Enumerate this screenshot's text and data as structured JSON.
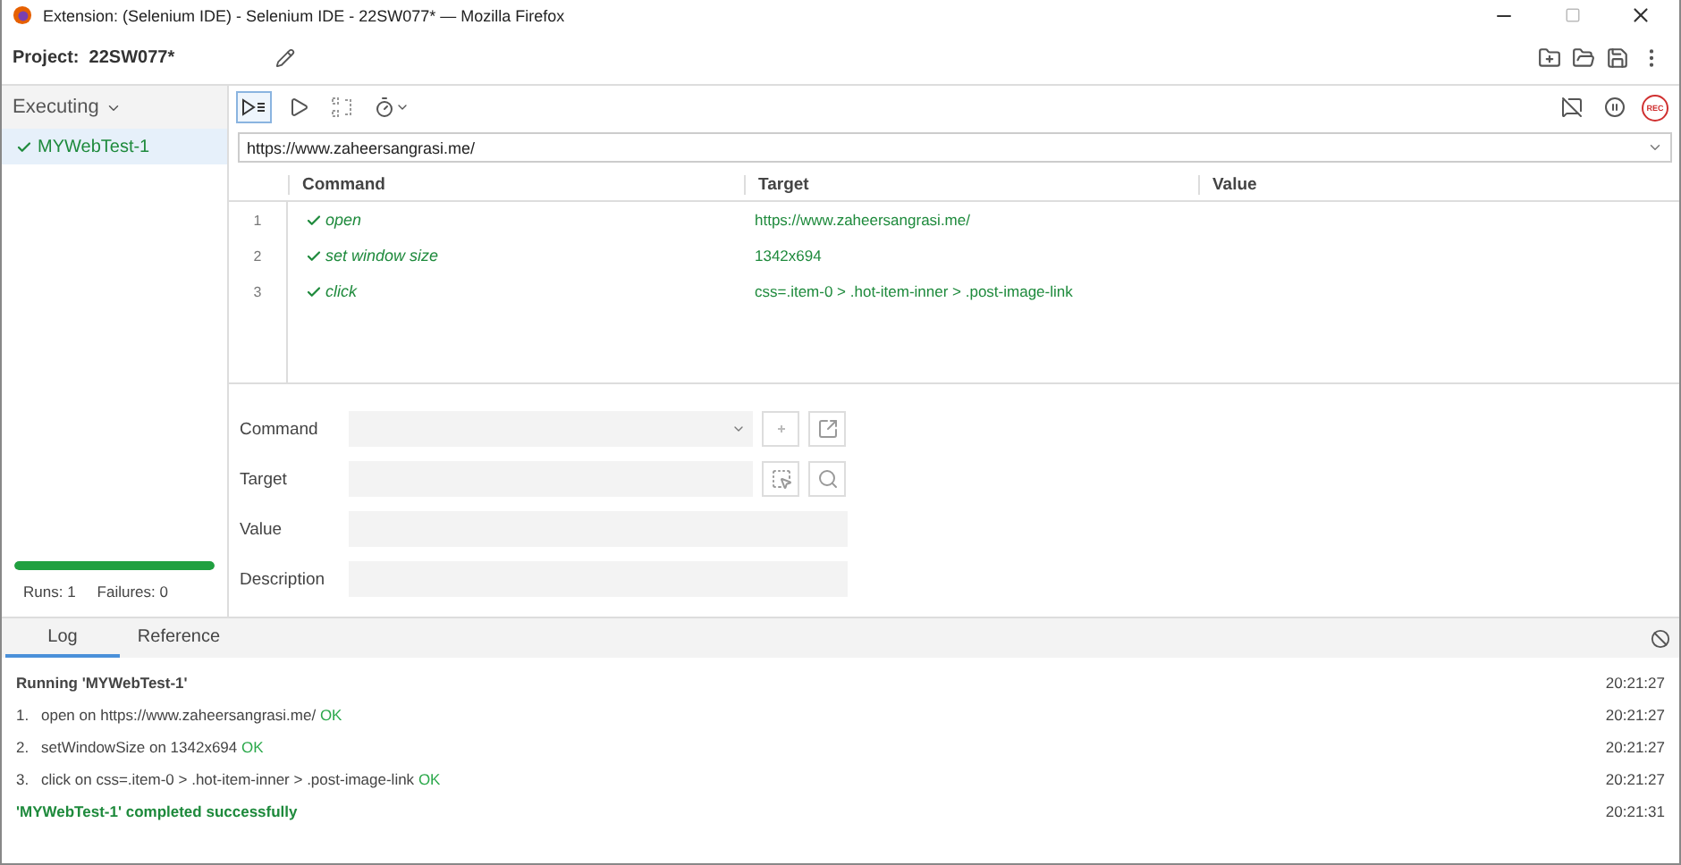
{
  "window": {
    "title": "Extension: (Selenium IDE) - Selenium IDE - 22SW077* — Mozilla Firefox"
  },
  "project": {
    "label": "Project:",
    "name": "22SW077*"
  },
  "sidebar": {
    "dropdown": "Executing",
    "tests": [
      {
        "name": "MYWebTest-1",
        "passed": true,
        "selected": true
      }
    ],
    "progress": {
      "level": 1
    },
    "runs": "Runs: 1",
    "failures": "Failures: 0"
  },
  "toolbar": {
    "record_label": "REC"
  },
  "url": "https://www.zaheersangrasi.me/",
  "table": {
    "columns": [
      "Command",
      "Target",
      "Value"
    ],
    "rows": [
      {
        "index": "1",
        "command": "open",
        "target": "https://www.zaheersangrasi.me/",
        "passed": true
      },
      {
        "index": "2",
        "command": "set window size",
        "target": "1342x694",
        "passed": true
      },
      {
        "index": "3",
        "command": "click",
        "target": "css=.item-0 > .hot-item-inner > .post-image-link",
        "passed": true
      }
    ]
  },
  "form": {
    "fields": [
      {
        "label": "Command",
        "kind": "select"
      },
      {
        "label": "Target",
        "kind": "target"
      },
      {
        "label": "Value",
        "kind": "text"
      },
      {
        "label": "Description",
        "kind": "text"
      }
    ]
  },
  "log": {
    "tabs": [
      {
        "label": "Log",
        "selected": true
      },
      {
        "label": "Reference",
        "selected": false
      }
    ],
    "entries": [
      {
        "kind": "heading",
        "text": "Running 'MYWebTest-1'",
        "time": "20:21:27"
      },
      {
        "kind": "step",
        "number": "1.",
        "text": "open on https://www.zaheersangrasi.me/",
        "result": "OK",
        "time": "20:21:27"
      },
      {
        "kind": "step",
        "number": "2.",
        "text": "setWindowSize on 1342x694",
        "result": "OK",
        "time": "20:21:27"
      },
      {
        "kind": "step",
        "number": "3.",
        "text": "click on css=.item-0 > .hot-item-inner > .post-image-link",
        "result": "OK",
        "time": "20:21:27"
      },
      {
        "kind": "success",
        "text": "'MYWebTest-1' completed successfully",
        "time": "20:21:31"
      }
    ]
  }
}
